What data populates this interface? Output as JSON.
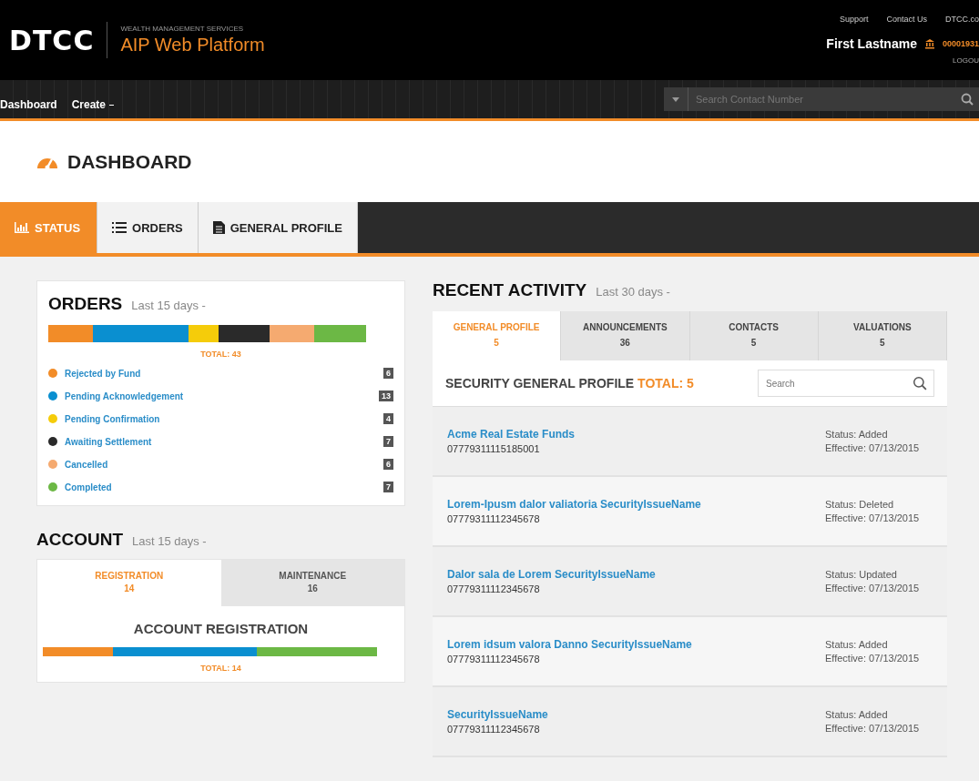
{
  "header": {
    "logo": "DTCC",
    "tagline": "WEALTH MANAGEMENT SERVICES",
    "product": "AIP Web Platform",
    "links": [
      "Support",
      "Contact Us",
      "DTCC.co"
    ],
    "user": "First Lastname",
    "account": "00001931",
    "logout": "LOGOU"
  },
  "nav": {
    "items": [
      {
        "label": "Dashboard",
        "dropdown": false
      },
      {
        "label": "Create",
        "dropdown": true
      }
    ],
    "search": {
      "placeholder": "Search Contact Number"
    }
  },
  "page_title": "DASHBOARD",
  "tabs": [
    {
      "label": "STATUS",
      "selected": true
    },
    {
      "label": "ORDERS",
      "selected": false
    },
    {
      "label": "GENERAL PROFILE",
      "selected": false
    }
  ],
  "orders": {
    "title": "ORDERS",
    "period": "Last 15 days -",
    "total": "TOTAL: 43",
    "items": [
      {
        "label": "Rejected by Fund",
        "count": "6",
        "color": "#f28c28"
      },
      {
        "label": "Pending Acknowledgement",
        "count": "13",
        "color": "#0a8fd0"
      },
      {
        "label": "Pending Confirmation",
        "count": "4",
        "color": "#f5cc0a"
      },
      {
        "label": "Awaiting Settlement",
        "count": "7",
        "color": "#2a2a2a"
      },
      {
        "label": "Cancelled",
        "count": "6",
        "color": "#f5aa70"
      },
      {
        "label": "Completed",
        "count": "7",
        "color": "#6cb845"
      }
    ]
  },
  "account": {
    "title": "ACCOUNT",
    "period": "Last 15 days -",
    "tabs": [
      {
        "label": "REGISTRATION",
        "count": "14",
        "selected": true
      },
      {
        "label": "MAINTENANCE",
        "count": "16",
        "selected": false
      }
    ],
    "heading": "ACCOUNT REGISTRATION",
    "segments": [
      {
        "color": "#f28c28"
      },
      {
        "color": "#0a8fd0"
      },
      {
        "color": "#6cb845"
      }
    ],
    "total": "TOTAL: 14"
  },
  "recent": {
    "title": "RECENT ACTIVITY",
    "period": "Last 30 days -",
    "tabs": [
      {
        "label": "GENERAL PROFILE",
        "count": "5",
        "selected": true
      },
      {
        "label": "ANNOUNCEMENTS",
        "count": "36",
        "selected": false
      },
      {
        "label": "CONTACTS",
        "count": "5",
        "selected": false
      },
      {
        "label": "VALUATIONS",
        "count": "5",
        "selected": false
      }
    ],
    "list_title": "SECURITY GENERAL PROFILE",
    "list_total": "TOTAL: 5",
    "search": {
      "placeholder": "Search"
    },
    "rows": [
      {
        "name": "Acme Real Estate Funds",
        "number": "07779311115185001",
        "status": "Status: Added",
        "effective": "Effective: 07/13/2015"
      },
      {
        "name": "Lorem-Ipusm dalor valiatoria SecurityIssueName",
        "number": "07779311112345678",
        "status": "Status: Deleted",
        "effective": "Effective: 07/13/2015"
      },
      {
        "name": "Dalor sala de Lorem SecurityIssueName",
        "number": "07779311112345678",
        "status": "Status: Updated",
        "effective": "Effective: 07/13/2015"
      },
      {
        "name": "Lorem idsum valora Danno SecurityIssueName",
        "number": "07779311112345678",
        "status": "Status: Added",
        "effective": "Effective: 07/13/2015"
      },
      {
        "name": "SecurityIssueName",
        "number": "07779311112345678",
        "status": "Status: Added",
        "effective": "Effective: 07/13/2015"
      }
    ]
  }
}
